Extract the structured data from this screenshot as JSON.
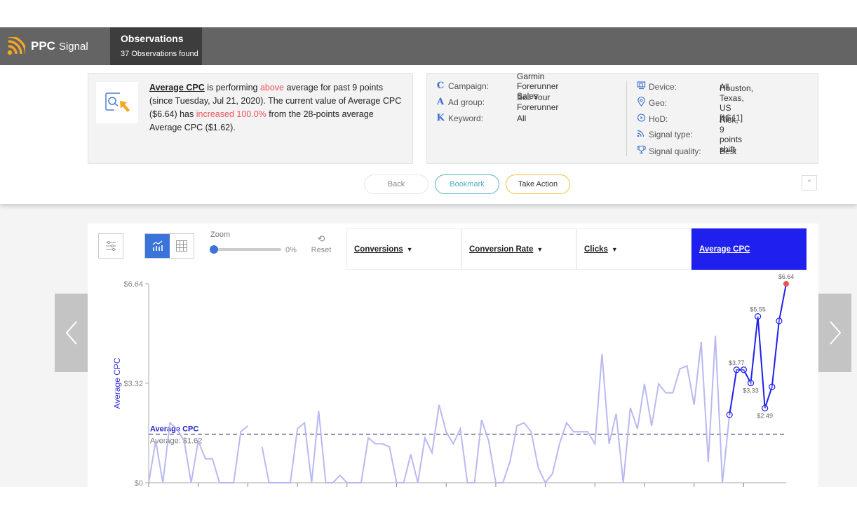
{
  "header": {
    "brand_bold": "PPC",
    "brand_light": "Signal",
    "section_title": "Observations",
    "section_subtitle": "37 Observations found"
  },
  "insight": {
    "metric": "Average CPC",
    "text_1": " is performing ",
    "direction": "above",
    "text_2": " average for past 9 points (since Tuesday, Jul 21, 2020). The current value of Average CPC ($6.64) has ",
    "change": "increased 100.0%",
    "text_3": " from the 28-points average Average CPC ($1.62)."
  },
  "details_left": [
    {
      "icon": "C",
      "icon_name": "campaign-icon",
      "label": "Campaign:",
      "value": "Garmin Forerunner Sales"
    },
    {
      "icon": "A",
      "icon_name": "ad-group-icon",
      "label": "Ad group:",
      "value": "Sell Your Forerunner"
    },
    {
      "icon": "K",
      "icon_name": "keyword-icon",
      "label": "Keyword:",
      "value": "All"
    }
  ],
  "details_right": [
    {
      "icon_name": "device-icon",
      "label": "Device:",
      "value": "All"
    },
    {
      "icon_name": "geo-pin-icon",
      "label": "Geo:",
      "value": "Houston, Texas, US [*G11]"
    },
    {
      "icon_name": "clock-icon",
      "label": "HoD:",
      "value": "All"
    },
    {
      "icon_name": "signal-icon",
      "label": "Signal type:",
      "value": "Risk, 9 points shift"
    },
    {
      "icon_name": "trophy-icon",
      "label": "Signal quality:",
      "value": "Best"
    }
  ],
  "actions": {
    "back": "Back",
    "bookmark": "Bookmark",
    "take_action": "Take Action"
  },
  "toolbar": {
    "zoom_label": "Zoom",
    "zoom_value": "0%",
    "zoom_fraction": 0,
    "reset_label": "Reset"
  },
  "metric_tabs": [
    {
      "label": "Conversions",
      "dropdown": true,
      "active": false
    },
    {
      "label": "Conversion Rate",
      "dropdown": true,
      "active": false
    },
    {
      "label": "Clicks",
      "dropdown": true,
      "active": false
    },
    {
      "label": "Average CPC",
      "dropdown": false,
      "active": true
    }
  ],
  "colors": {
    "accent_blue": "#1f1fee",
    "history_line": "#b9b9f2",
    "highlight_red": "#e8545a",
    "brand_orange": "#f5a623"
  },
  "chart_data": {
    "type": "line",
    "ylabel": "Average CPC",
    "yticks": [
      "$0",
      "$3.32",
      "$6.64"
    ],
    "ylim": [
      0,
      6.64
    ],
    "grid": false,
    "average_line": {
      "label": "Average CPC",
      "sublabel": "Average: $1.62",
      "value": 1.62
    },
    "series": [
      {
        "name": "history",
        "values": [
          0,
          1.4,
          0,
          2.0,
          1.8,
          1.4,
          0,
          1.4,
          0.8,
          0.8,
          0,
          0,
          0,
          1.7,
          1.9,
          null,
          1.2,
          0,
          0,
          0,
          0,
          1.8,
          2.0,
          0,
          2.4,
          0,
          0,
          0.25,
          0,
          0,
          0,
          1.5,
          1.3,
          1.3,
          1.2,
          0,
          0,
          0.95,
          0,
          1.5,
          1.0,
          2.6,
          1.7,
          1.3,
          1.8,
          0,
          0,
          2.1,
          1.4,
          0,
          0,
          0.7,
          1.9,
          2.0,
          1.7,
          0.5,
          0,
          0.3,
          1.3,
          2.0,
          1.7,
          1.7,
          1.7,
          1.3,
          4.3,
          1.3,
          2.3,
          0,
          2.5,
          1.8,
          3.3,
          1.9,
          3.3,
          3.0,
          3.0,
          3.8,
          3.9,
          2.6,
          4.7,
          0.7,
          4.9,
          0,
          2.27
        ]
      },
      {
        "name": "signal",
        "values": [
          2.27,
          3.77,
          3.77,
          3.33,
          5.55,
          2.49,
          3.2,
          5.4,
          6.64
        ],
        "labels": [
          "",
          "$3.77",
          "",
          "$3.33",
          "$5.55",
          "$2.49",
          "",
          "",
          "$6.64"
        ]
      }
    ]
  }
}
